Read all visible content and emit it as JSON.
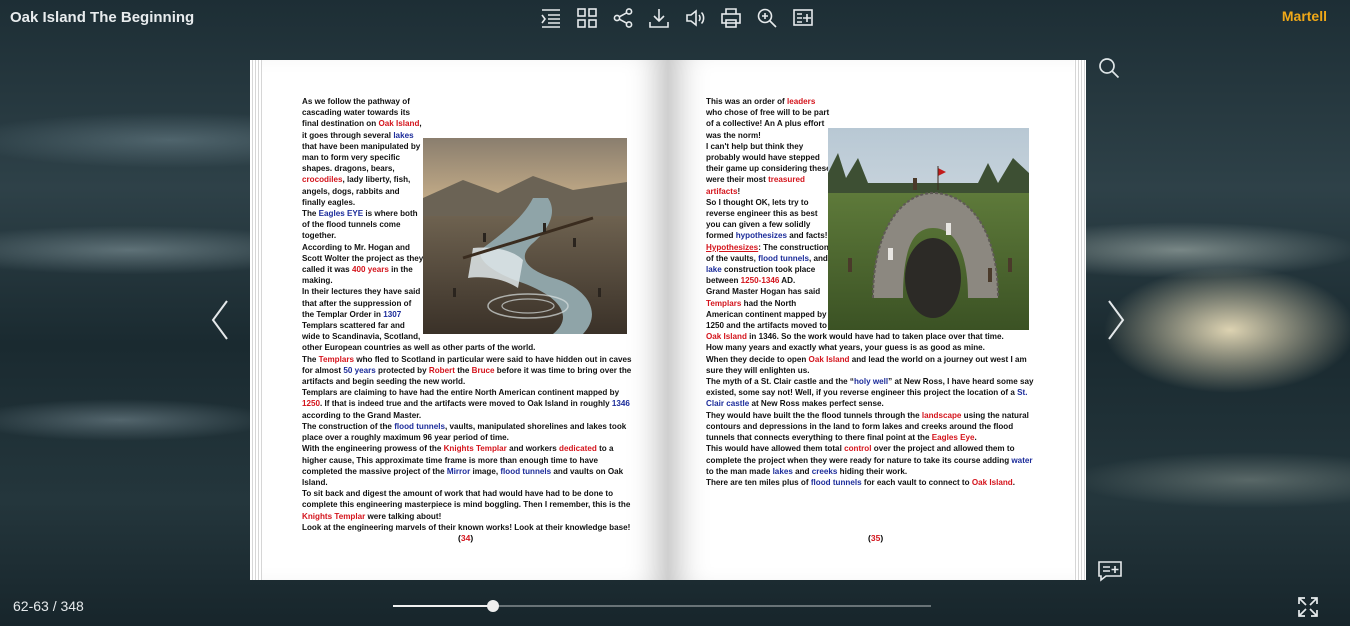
{
  "header": {
    "title": "Oak Island The Beginning",
    "author": "Martell"
  },
  "toolbar": {
    "icons": [
      "table-of-contents-icon",
      "thumbnails-icon",
      "share-icon",
      "download-icon",
      "sound-icon",
      "print-icon",
      "zoom-icon",
      "add-bookmark-icon"
    ]
  },
  "left_page": {
    "lines": [
      [
        "As we follow the pathway of cascading water towards its final destination on ",
        {
          "r": "Oak Island"
        },
        ", it goes through several ",
        {
          "b": "lakes"
        },
        " that have been manipulated by man to form very specific shapes. dragons, bears, ",
        {
          "r": "crocodiles"
        },
        ", lady liberty, fish, angels, dogs, rabbits and finally eagles."
      ],
      [
        "The ",
        {
          "b": "Eagles EYE"
        },
        " is where both of the flood tunnels come together."
      ],
      [
        "According to Mr. Hogan and Scott Wolter the project as they called it was ",
        {
          "r": "400 years"
        },
        " in the making."
      ],
      [
        "In their lectures they have said that after the suppression of the Templar Order in ",
        {
          "b": "1307"
        },
        " Templars scattered far and wide to Scandinavia, Scotland, other European countries as well as other parts of the world."
      ],
      [
        "The ",
        {
          "r": "Templars"
        },
        " who fled to Scotland in particular were said to have hidden out in caves for almost ",
        {
          "b": "50 years"
        },
        " protected by ",
        {
          "r": "Robert"
        },
        " the ",
        {
          "r": "Bruce"
        },
        " before it was time to bring over the artifacts and begin seeding the new world."
      ],
      [
        "Templars are claiming to have had the entire North American continent mapped by ",
        {
          "r": "1250"
        },
        ". If that is indeed true and the artifacts were moved to Oak Island in roughly ",
        {
          "b": "1346"
        },
        " according to the Grand Master."
      ],
      [
        "The construction of the ",
        {
          "b": "flood tunnels"
        },
        ", vaults, manipulated shorelines and lakes took place over a roughly maximum 96 year period of time."
      ],
      [
        "With the engineering prowess of the ",
        {
          "r": "Knights Templar"
        },
        " and workers ",
        {
          "r": "dedicated"
        },
        " to a higher cause, This approximate time frame is more than enough time to have completed the massive project of the ",
        {
          "b": "Mirror"
        },
        " image, ",
        {
          "b": "flood tunnels"
        },
        " and vaults on Oak Island."
      ],
      [
        "To sit back and digest the amount of work that had would have had to be done to complete this engineering masterpiece is mind boggling. Then I remember, this is the ",
        {
          "r": "Knights Templar"
        },
        " were talking about!"
      ],
      [
        "Look at the engineering marvels of their known works! Look at their knowledge base!"
      ]
    ],
    "page_number": "34"
  },
  "right_page": {
    "lines": [
      [
        "This was an order of ",
        {
          "r": "leaders"
        },
        " who chose of free will to be part of a collective! An A plus effort was the norm!"
      ],
      [
        "I can't help but think they probably would have stepped their game up considering these were their most ",
        {
          "r": "treasured artifacts"
        },
        "!"
      ],
      [
        "So I thought OK, lets try to reverse engineer this as best you can given a few solidly formed ",
        {
          "b": "hypothesizes"
        },
        " and facts!"
      ],
      [
        {
          "ru": "Hypothesizes"
        },
        ": The construction of the vaults, ",
        {
          "b": "flood tunnels"
        },
        ", and ",
        {
          "b": "lake"
        },
        " construction took place between ",
        {
          "r": "1250-1346"
        },
        " AD."
      ],
      [
        "Grand Master Hogan has said ",
        {
          "r": "Templars"
        },
        " had the North American continent mapped by 1250 and the artifacts moved to ",
        {
          "r": "Oak Island"
        },
        " in 1346. So the work would have had to taken place over that time."
      ],
      [
        "How many years and exactly what years, your guess is as good as mine."
      ],
      [
        "When they decide to open ",
        {
          "r": "Oak Island"
        },
        " and lead the world on a journey out west I am sure they will enlighten us."
      ],
      [
        "The myth of a St. Clair castle and the “",
        {
          "b": "holy well"
        },
        "” at New Ross, I have heard some say existed, some say not! Well, if you reverse engineer this project the location of a ",
        {
          "b": "St. Clair castle"
        },
        " at New Ross makes perfect sense."
      ],
      [
        "They would have built the the flood tunnels through the ",
        {
          "r": "landscape"
        },
        " using the natural contours and depressions in the land to form lakes and creeks around the flood tunnels that connects everything to there final point at the ",
        {
          "r": "Eagles Eye"
        },
        "."
      ],
      [
        "This would have allowed them total ",
        {
          "r": "control"
        },
        " over the project and allowed them to complete the project when they were ready for nature to take its course adding ",
        {
          "b": "water"
        },
        " to the man made ",
        {
          "b": "lakes"
        },
        " and ",
        {
          "b": "creeks"
        },
        " hiding their work."
      ],
      [
        "There are ten miles plus of ",
        {
          "b": "flood tunnels"
        },
        " for each vault to connect to ",
        {
          "r": "Oak Island"
        },
        "."
      ]
    ],
    "page_number": "35"
  },
  "footer": {
    "page_indicator": "62-63 / 348",
    "progress": 0.185
  }
}
